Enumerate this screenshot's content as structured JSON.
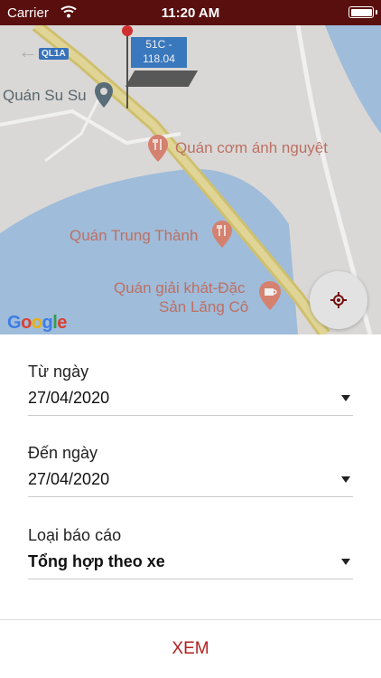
{
  "status_bar": {
    "carrier": "Carrier",
    "time": "11:20 AM"
  },
  "map": {
    "road_label": "QL1A",
    "vehicle_plate_line1": "51C -",
    "vehicle_plate_line2": "118.04",
    "pois": [
      {
        "name": "Quán Su Su"
      },
      {
        "name": "Quán cơm ánh nguyệt"
      },
      {
        "name": "Quán Trung Thành"
      },
      {
        "name": "Quán giải khát-Đặc"
      },
      {
        "name": "Sản Lăng Cô"
      }
    ],
    "attribution": "Google"
  },
  "form": {
    "from_date": {
      "label": "Từ ngày",
      "value": "27/04/2020"
    },
    "to_date": {
      "label": "Đến ngày",
      "value": "27/04/2020"
    },
    "report_type": {
      "label": "Loại báo cáo",
      "value": "Tổng hợp theo xe"
    }
  },
  "submit_label": "XEM",
  "colors": {
    "status_bar": "#5a0f0f",
    "accent": "#b52020",
    "water": "#a9c8e8",
    "road": "#e2d27a"
  }
}
